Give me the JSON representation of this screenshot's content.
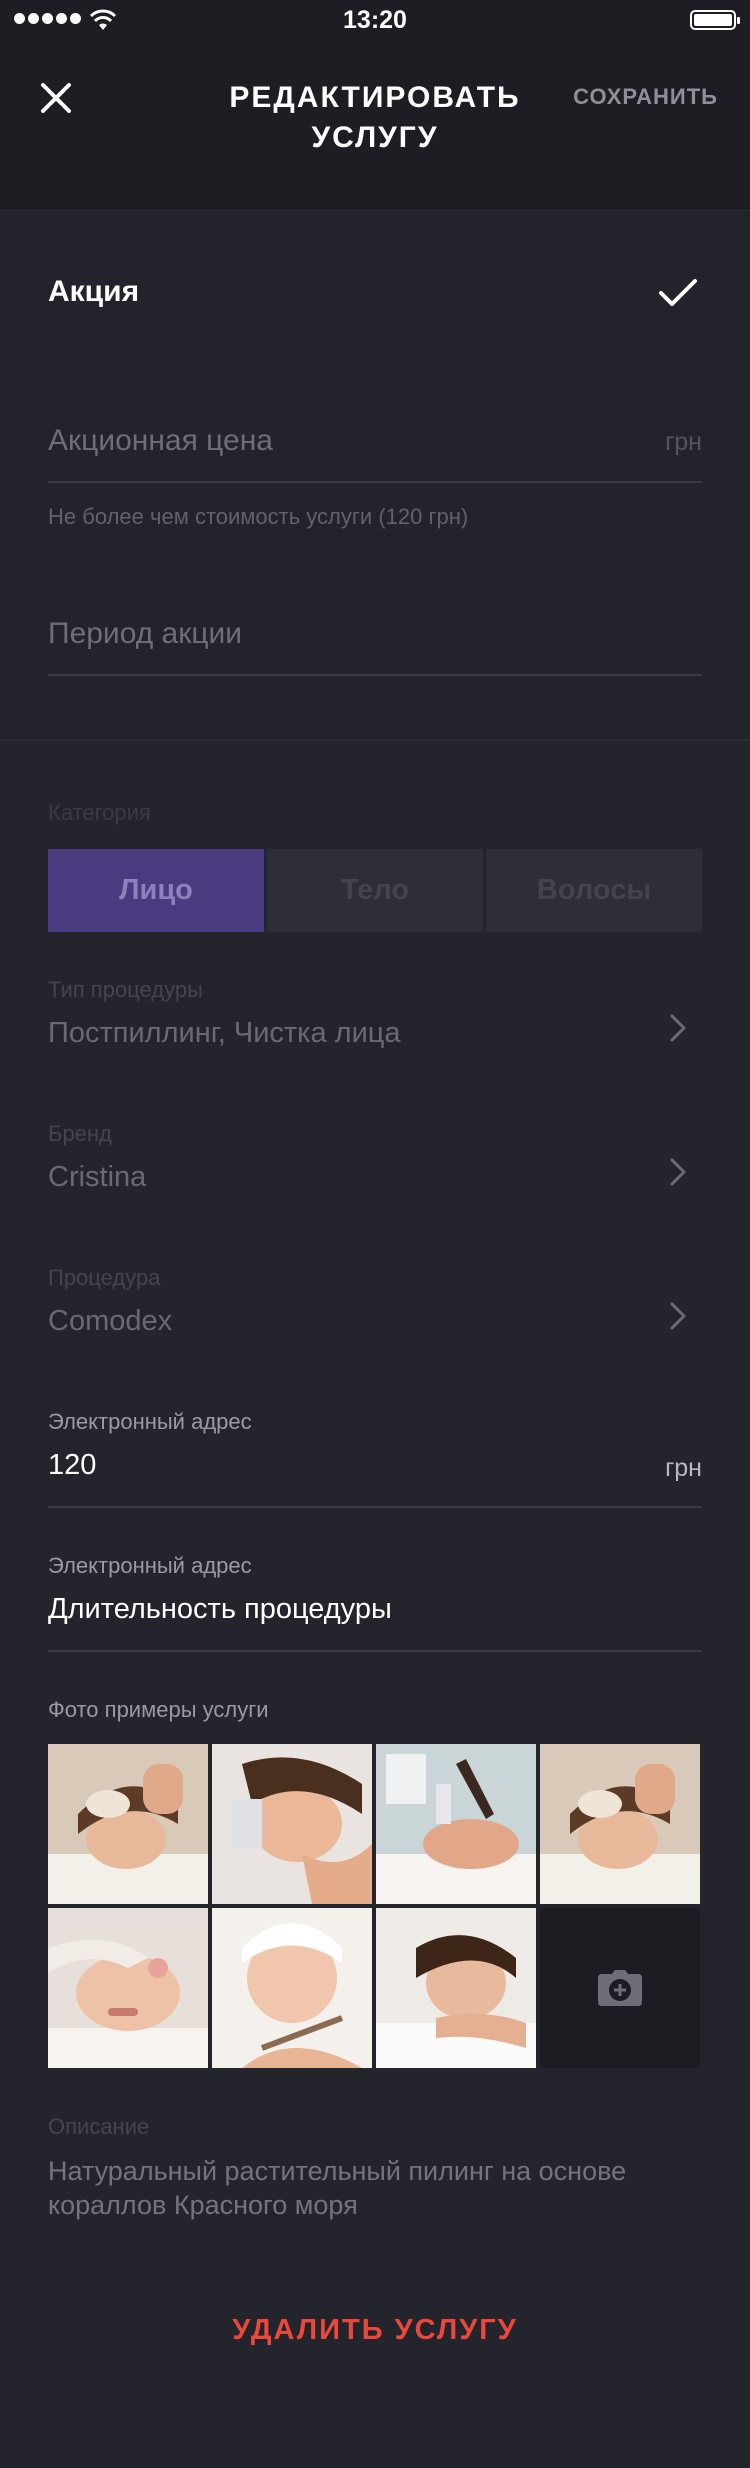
{
  "status_bar": {
    "time": "13:20"
  },
  "header": {
    "title": "РЕДАКТИРОВАТЬ УСЛУГУ",
    "save_label": "СОХРАНИТЬ"
  },
  "promo": {
    "toggle_label": "Акция",
    "checked": true,
    "price_placeholder": "Акционная цена",
    "price_currency": "грн",
    "price_hint": "Не более чем стоимость услуги (120 грн)",
    "period_placeholder": "Период акции"
  },
  "category": {
    "label": "Категория",
    "options": [
      "Лицо",
      "Тело",
      "Волосы"
    ],
    "selected": "Лицо"
  },
  "procedure_type": {
    "label": "Тип процедуры",
    "value": "Постпиллинг, Чистка лица"
  },
  "brand": {
    "label": "Бренд",
    "value": "Cristina"
  },
  "procedure": {
    "label": "Процедура",
    "value": "Comodex"
  },
  "price_field": {
    "label": "Электронный адрес",
    "value": "120",
    "currency": "грн"
  },
  "duration_field": {
    "label": "Электронный адрес",
    "value": "Длительность процедуры"
  },
  "photos": {
    "label": "Фото примеры услуги",
    "items": [
      "face-massage-photo",
      "facial-cleansing-photo",
      "microdermabrasion-photo",
      "face-massage-photo",
      "face-mask-photo",
      "face-mask-brush-photo",
      "woman-profile-photo"
    ],
    "add_icon": "camera-plus-icon"
  },
  "description": {
    "label": "Описание",
    "text_line1": "Натуральный растительный пилинг на основе",
    "text_line2": "кораллов Красного моря"
  },
  "delete_label": "УДАЛИТЬ УСЛУГУ",
  "colors": {
    "accent": "#4a3a7f",
    "danger": "#e9483c",
    "background": "#24242d"
  }
}
